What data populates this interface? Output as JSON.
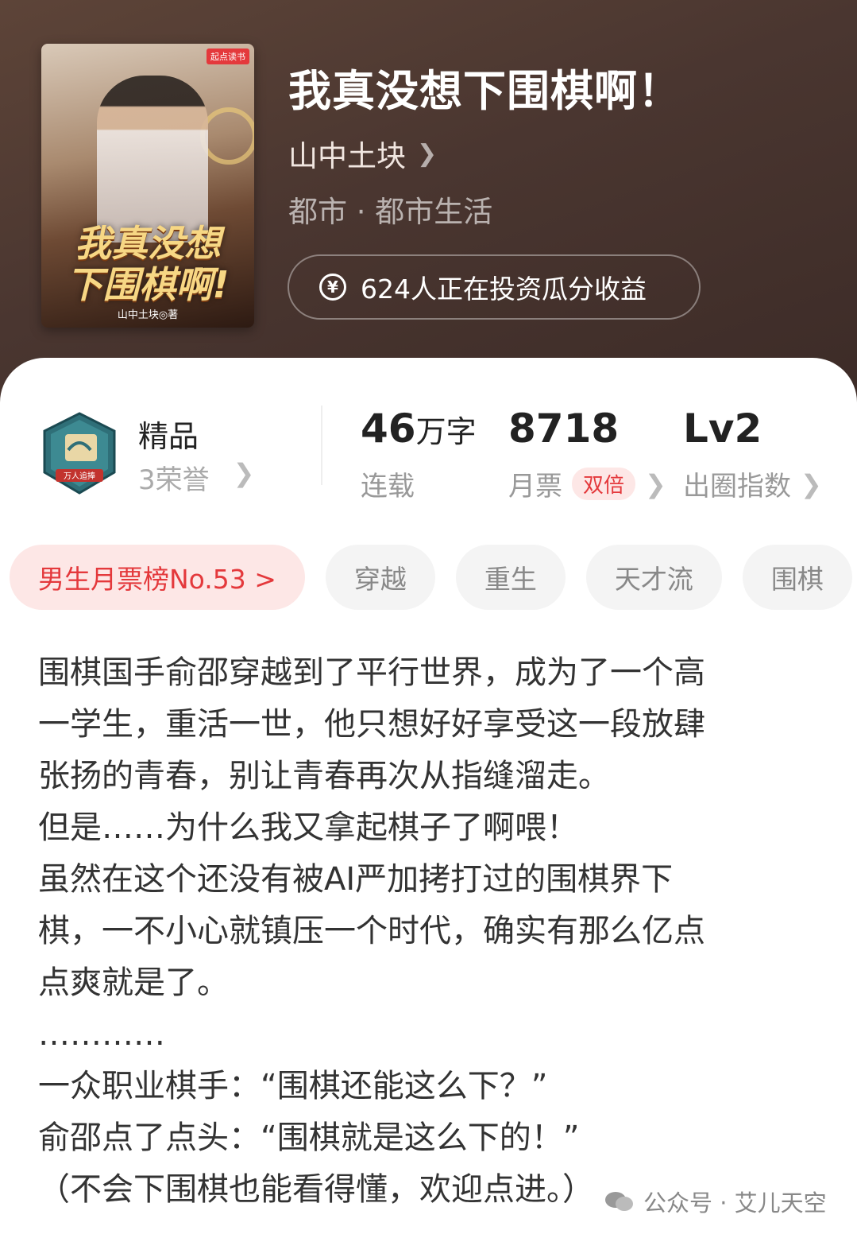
{
  "book": {
    "title": "我真没想下围棋啊！",
    "author": "山中土块",
    "genre": "都市 · 都市生活",
    "invest_text": "624人正在投资瓜分收益"
  },
  "cover": {
    "badge": "起点读书",
    "title_line1": "我真没想",
    "title_line2": "下围棋啊!",
    "author_text": "山中土块◎著"
  },
  "honor": {
    "badge_text": "万人追捧",
    "title": "精品",
    "subtitle": "3荣誉"
  },
  "stats": {
    "words": {
      "value": "46",
      "unit": "万字",
      "label": "连载"
    },
    "monthly_tickets": {
      "value": "8718",
      "label": "月票",
      "badge": "双倍"
    },
    "index": {
      "value": "Lv2",
      "label": "出圈指数"
    }
  },
  "tags": {
    "rank": "男生月票榜No.53 >",
    "items": [
      "穿越",
      "重生",
      "天才流",
      "围棋"
    ]
  },
  "description": [
    "围棋国手俞邵穿越到了平行世界，成为了一个高",
    "一学生，重活一世，他只想好好享受这一段放肆",
    "张扬的青春，别让青春再次从指缝溜走。",
    "但是……为什么我又拿起棋子了啊喂！",
    "虽然在这个还没有被AI严加拷打过的围棋界下",
    "棋，一不小心就镇压一个时代，确实有那么亿点",
    "点爽就是了。",
    "…………",
    "一众职业棋手：“围棋还能这么下？”",
    "俞邵点了点头：“围棋就是这么下的！”",
    "（不会下围棋也能看得懂，欢迎点进。）"
  ],
  "watermark": "公众号 · 艾儿天空",
  "colors": {
    "accent": "#e4393c",
    "hero": "#4a3630"
  }
}
